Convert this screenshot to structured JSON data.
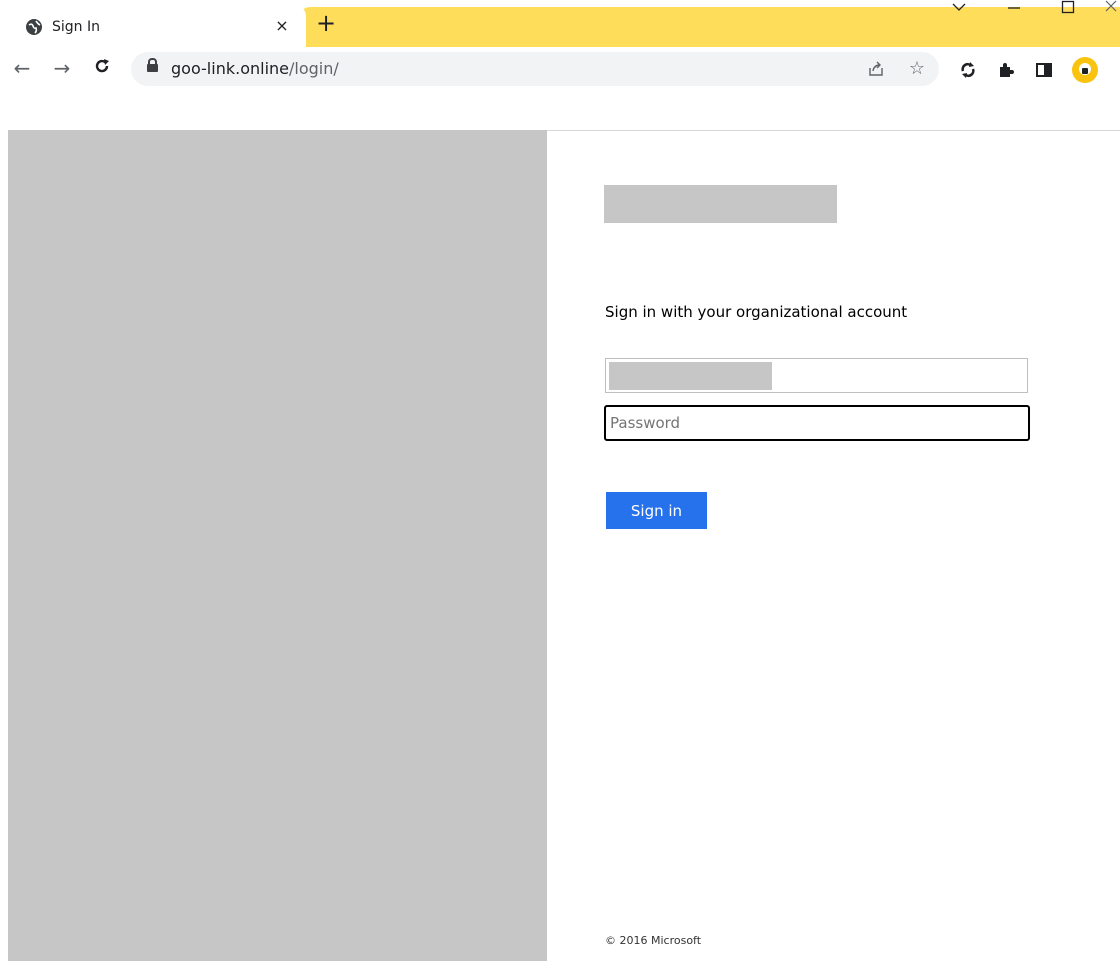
{
  "browser": {
    "tab": {
      "title": "Sign In",
      "close_glyph": "×"
    },
    "new_tab_glyph": "+",
    "window_controls": {
      "dropdown": "⌄",
      "minimize": "–",
      "maximize": "☐",
      "close": "×"
    },
    "nav": {
      "back": "←",
      "forward": "→",
      "reload": "C"
    },
    "address": {
      "host": "goo-link.online",
      "path": "/login/"
    },
    "icons": [
      "globe-icon",
      "lock-icon",
      "share-icon",
      "star-icon",
      "sync-icon",
      "extensions-icon",
      "side-panel-icon",
      "profile-avatar"
    ],
    "icon_glyphs": {
      "share": "⇪",
      "star": "☆",
      "sync": "↻",
      "extensions": "✱",
      "side_panel": "◧"
    }
  },
  "login": {
    "heading": "Sign in with your organizational account",
    "password_placeholder": "Password",
    "signin_label": "Sign in",
    "footer": "© 2016 Microsoft"
  },
  "colors": {
    "tabstrip": "#fedd5b",
    "signin_button": "#2672ec",
    "placeholder_gray": "#c6c6c6"
  }
}
